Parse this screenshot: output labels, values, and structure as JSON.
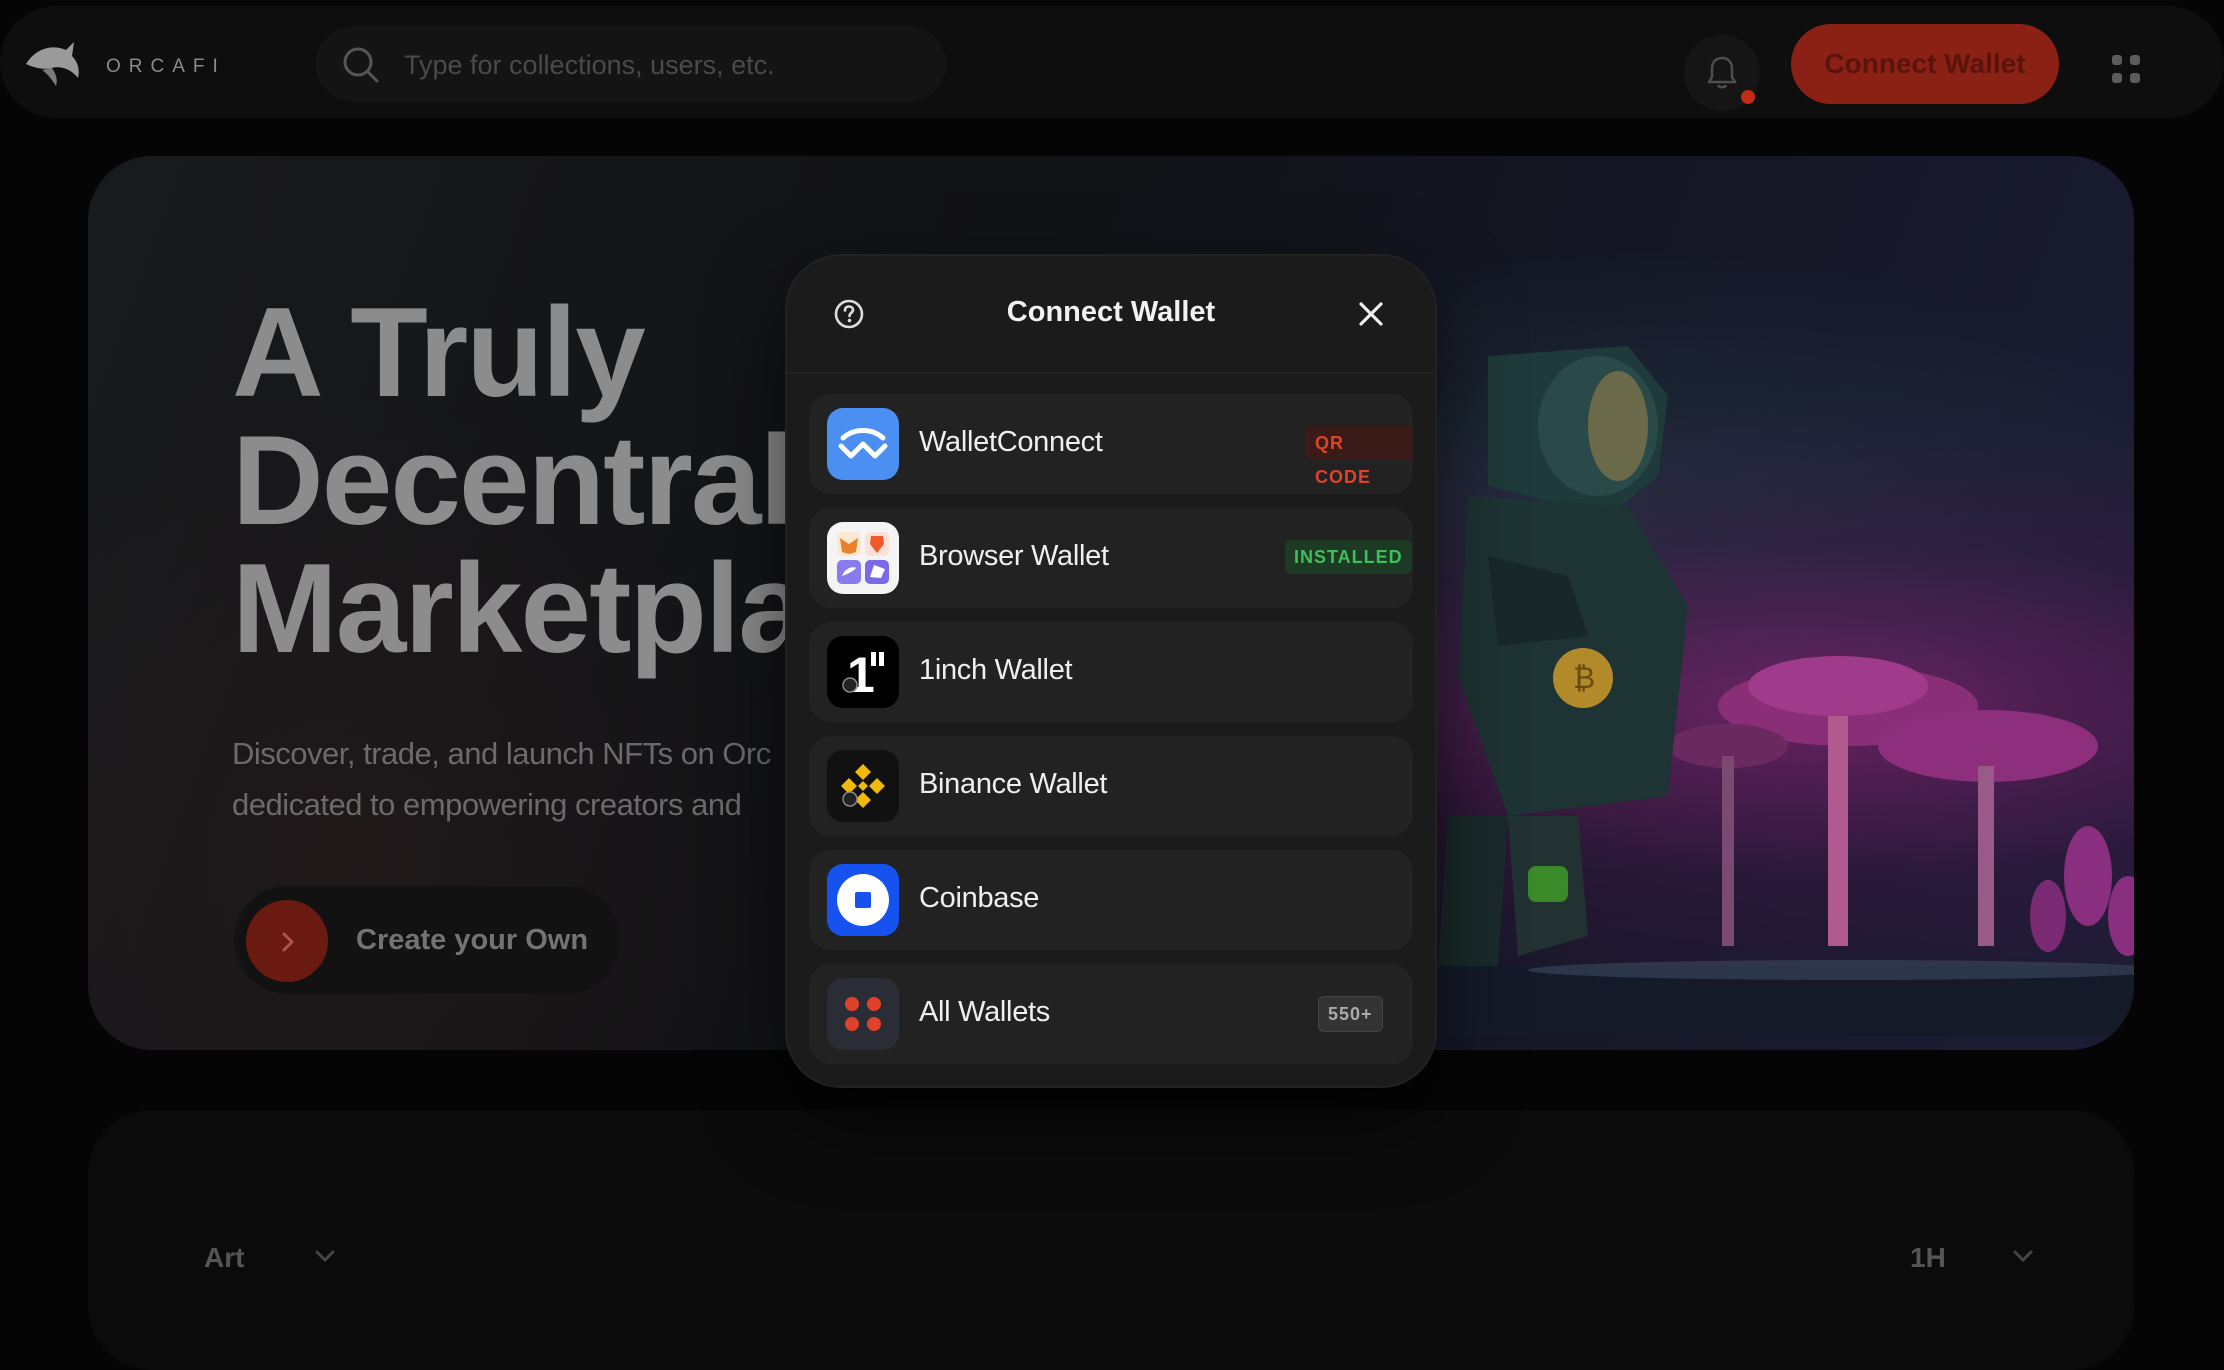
{
  "brand": {
    "name": "ORCAFI"
  },
  "search": {
    "placeholder": "Type for collections, users, etc."
  },
  "header": {
    "connect_label": "Connect Wallet"
  },
  "hero": {
    "headline": [
      "A Truly",
      "Decentral",
      "Marketpla"
    ],
    "subtext": [
      "Discover, trade, and launch NFTs on Orc",
      "dedicated to empowering creators and"
    ],
    "cta_label": "Create your Own"
  },
  "filters": {
    "category": "Art",
    "timeframe": "1H"
  },
  "modal": {
    "title": "Connect Wallet",
    "wallets": [
      {
        "name": "WalletConnect",
        "badge": "QR CODE",
        "icon": "walletconnect-icon"
      },
      {
        "name": "Browser Wallet",
        "badge": "INSTALLED",
        "icon": "browser-wallet-icon"
      },
      {
        "name": "1inch Wallet",
        "badge": "",
        "icon": "1inch-icon"
      },
      {
        "name": "Binance Wallet",
        "badge": "",
        "icon": "binance-icon"
      },
      {
        "name": "Coinbase",
        "badge": "",
        "icon": "coinbase-icon"
      },
      {
        "name": "All Wallets",
        "badge": "550+",
        "icon": "all-wallets-icon"
      }
    ]
  },
  "colors": {
    "accent": "#8b2115",
    "badge_qr": "#e0412b",
    "badge_installed": "#3fbf5a",
    "walletconnect_blue": "#4c8ff2",
    "coinbase_blue": "#1652f0",
    "binance_yellow": "#f0b90b"
  }
}
